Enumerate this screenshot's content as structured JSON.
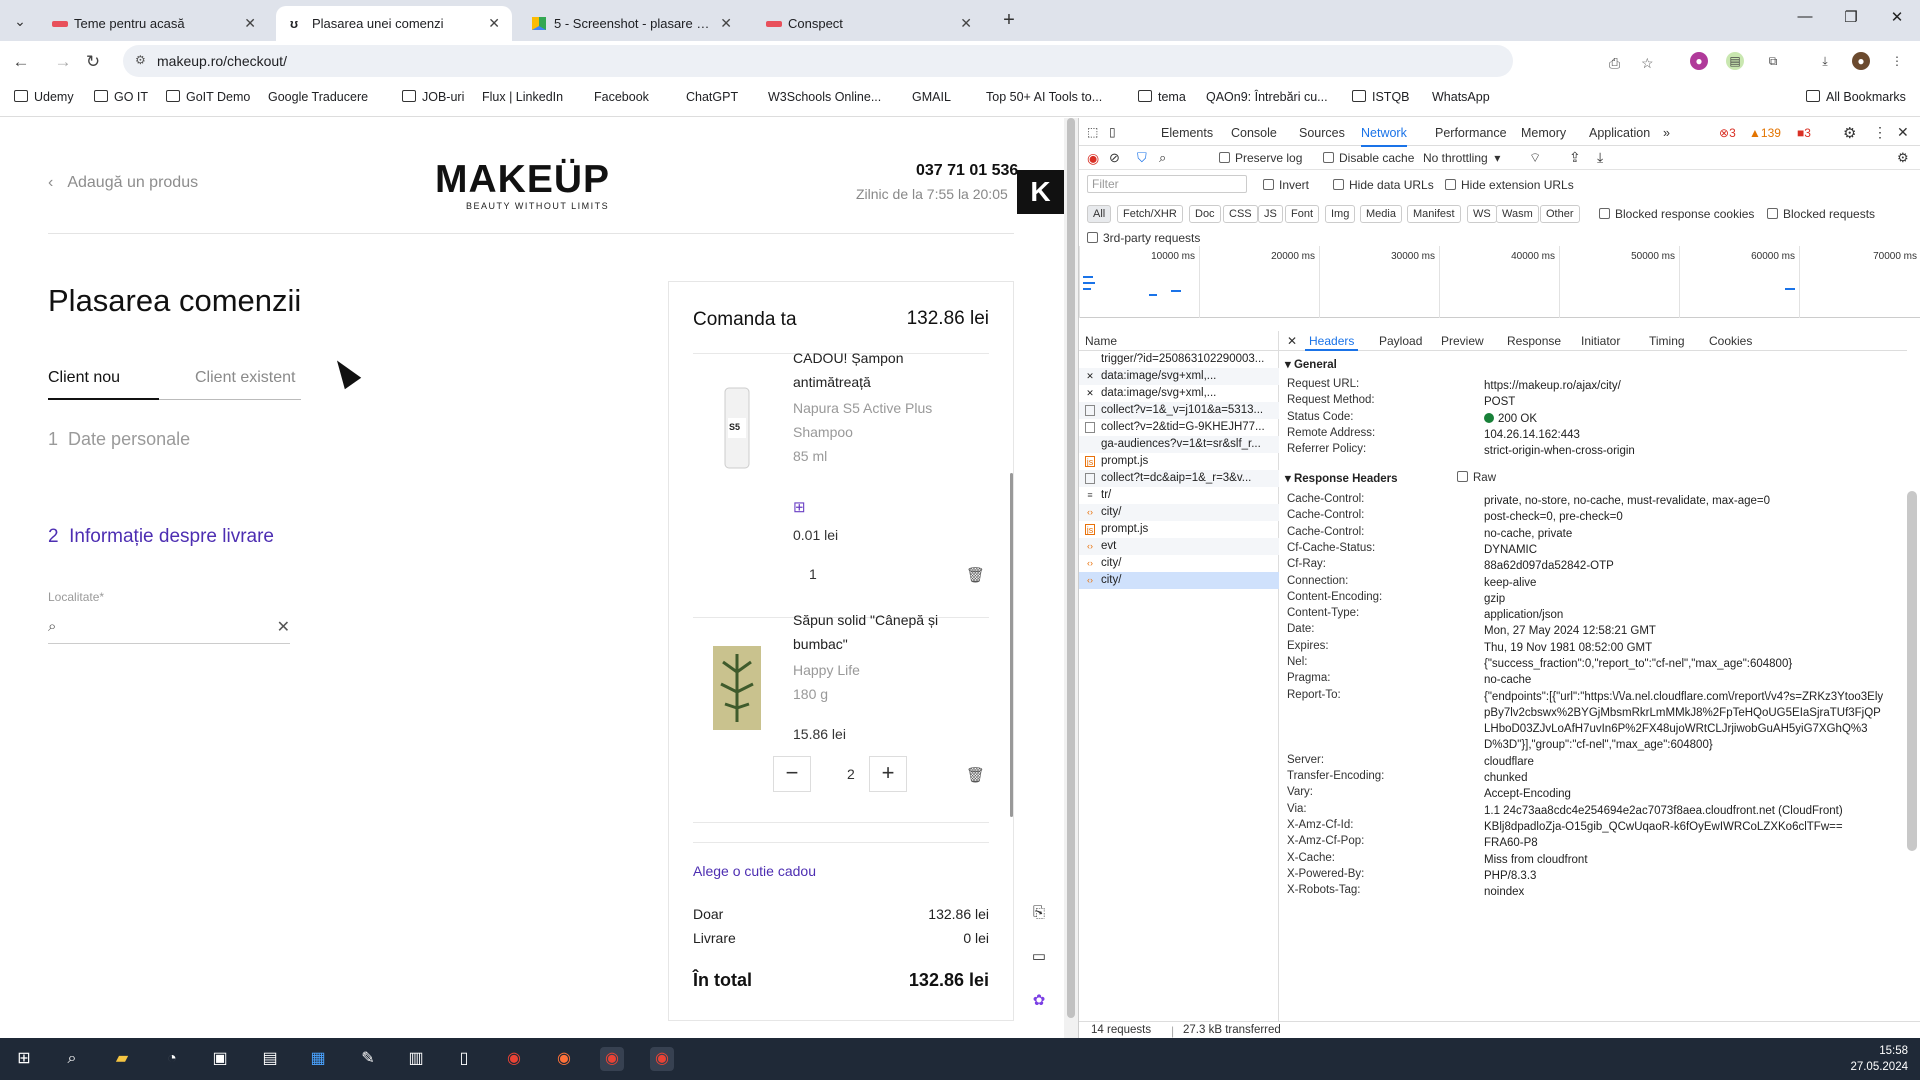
{
  "browser": {
    "tabs": [
      {
        "title": "Teme pentru acasă",
        "active": false
      },
      {
        "title": "Plasarea unei comenzi",
        "active": true
      },
      {
        "title": "5 - Screenshot - plasare comanda",
        "active": false
      },
      {
        "title": "Conspect",
        "active": false
      }
    ],
    "url": "makeup.ro/checkout/",
    "bookmarks": [
      "Udemy",
      "GO IT",
      "GoIT Demo",
      "Google Traducere",
      "JOB-uri",
      "Flux | LinkedIn",
      "Facebook",
      "ChatGPT",
      "W3Schools Online...",
      "GMAIL",
      "Top 50+ AI Tools to...",
      "tema",
      "QAOn9: Întrebări cu...",
      "ISTQB",
      "WhatsApp"
    ],
    "all_bookmarks": "All Bookmarks"
  },
  "site": {
    "back_label": "Adaugă un produs",
    "logo": "MAKEÜP",
    "logo_sub": "BEAUTY WITHOUT LIMITS",
    "phone": "037 71 01 536",
    "hours": "Zilnic de la 7:55 la 20:05",
    "badge": "K",
    "title": "Plasarea comenzii",
    "client_new": "Client nou",
    "client_existing": "Client existent",
    "step1_num": "1",
    "step1": "Date personale",
    "step2_num": "2",
    "step2": "Informație despre livrare",
    "locality_label": "Localitate*",
    "cart": {
      "title": "Comanda ta",
      "total": "132.86 lei",
      "items": [
        {
          "name": "CADOU! Șampon antimătreață",
          "brand": "Napura S5 Active Plus Shampoo",
          "volume": "85 ml",
          "price": "0.01 lei",
          "qty": "1"
        },
        {
          "name": "Săpun solid \"Cânepă și bumbac\"",
          "brand": "Happy Life",
          "volume": "180 g",
          "price": "15.86 lei",
          "qty": "2"
        }
      ],
      "gift_box": "Alege o cutie cadou",
      "subtotal_label": "Doar",
      "subtotal": "132.86 lei",
      "delivery_label": "Livrare",
      "delivery": "0 lei",
      "grand_label": "În total",
      "grand": "132.86 lei"
    }
  },
  "devtools": {
    "tabs": [
      "Elements",
      "Console",
      "Sources",
      "Network",
      "Performance",
      "Memory",
      "Application"
    ],
    "active_tab": "Network",
    "errors": "3",
    "warnings": "139",
    "issues": "3",
    "preserve_log": "Preserve log",
    "disable_cache": "Disable cache",
    "throttling": "No throttling",
    "filter_placeholder": "Filter",
    "invert": "Invert",
    "hide_data": "Hide data URLs",
    "hide_ext": "Hide extension URLs",
    "chips": [
      "All",
      "Fetch/XHR",
      "Doc",
      "CSS",
      "JS",
      "Font",
      "Img",
      "Media",
      "Manifest",
      "WS",
      "Wasm",
      "Other"
    ],
    "blocked_cookies": "Blocked response cookies",
    "blocked_requests": "Blocked requests",
    "third_party": "3rd-party requests",
    "ticks": [
      "10000 ms",
      "20000 ms",
      "30000 ms",
      "40000 ms",
      "50000 ms",
      "60000 ms",
      "70000 ms"
    ],
    "name_header": "Name",
    "requests": [
      "trigger/?id=250863102290003...",
      "data:image/svg+xml,...",
      "data:image/svg+xml,...",
      "collect?v=1&_v=j101&a=5313...",
      "collect?v=2&tid=G-9KHEJH77...",
      "ga-audiences?v=1&t=sr&slf_r...",
      "prompt.js",
      "collect?t=dc&aip=1&_r=3&v...",
      "tr/",
      "city/",
      "prompt.js",
      "evt",
      "city/",
      "city/"
    ],
    "detail_tabs": [
      "Headers",
      "Payload",
      "Preview",
      "Response",
      "Initiator",
      "Timing",
      "Cookies"
    ],
    "general_label": "General",
    "general": [
      [
        "Request URL:",
        "https://makeup.ro/ajax/city/"
      ],
      [
        "Request Method:",
        "POST"
      ],
      [
        "Status Code:",
        "200 OK"
      ],
      [
        "Remote Address:",
        "104.26.14.162:443"
      ],
      [
        "Referrer Policy:",
        "strict-origin-when-cross-origin"
      ]
    ],
    "resp_label": "Response Headers",
    "raw": "Raw",
    "response": [
      [
        "Cache-Control:",
        "private, no-store, no-cache, must-revalidate, max-age=0"
      ],
      [
        "Cache-Control:",
        "post-check=0, pre-check=0"
      ],
      [
        "Cache-Control:",
        "no-cache, private"
      ],
      [
        "Cf-Cache-Status:",
        "DYNAMIC"
      ],
      [
        "Cf-Ray:",
        "88a62d097da52842-OTP"
      ],
      [
        "Connection:",
        "keep-alive"
      ],
      [
        "Content-Encoding:",
        "gzip"
      ],
      [
        "Content-Type:",
        "application/json"
      ],
      [
        "Date:",
        "Mon, 27 May 2024 12:58:21 GMT"
      ],
      [
        "Expires:",
        "Thu, 19 Nov 1981 08:52:00 GMT"
      ],
      [
        "Nel:",
        "{\"success_fraction\":0,\"report_to\":\"cf-nel\",\"max_age\":604800}"
      ],
      [
        "Pragma:",
        "no-cache"
      ],
      [
        "Report-To:",
        "{\"endpoints\":[{\"url\":\"https:\\/\\/a.nel.cloudflare.com\\/report\\/v4?s=ZRKz3Ytoo3ElypBy7lv2cbswx%2BYGjMbsmRkrLmMMkJ8%2FpTeHQoUG5EIaSjraTUf3FjQPLHboD03ZJvLoAfH7uvIn6P%2FX48ujoWRtCLJrjiwobGuAH5yiG7XGhQ%3D%3D\"}],\"group\":\"cf-nel\",\"max_age\":604800}"
      ],
      [
        "Server:",
        "cloudflare"
      ],
      [
        "Transfer-Encoding:",
        "chunked"
      ],
      [
        "Vary:",
        "Accept-Encoding"
      ],
      [
        "Via:",
        "1.1 24c73aa8cdc4e254694e2ac7073f8aea.cloudfront.net (CloudFront)"
      ],
      [
        "X-Amz-Cf-Id:",
        "KBlj8dpadloZja-O15gib_QCwUqaoR-k6fOyEwIWRCoLZXKo6clTFw=="
      ],
      [
        "X-Amz-Cf-Pop:",
        "FRA60-P8"
      ],
      [
        "X-Cache:",
        "Miss from cloudfront"
      ],
      [
        "X-Powered-By:",
        "PHP/8.3.3"
      ],
      [
        "X-Robots-Tag:",
        "noindex"
      ]
    ],
    "footer_requests": "14 requests",
    "footer_transfer": "27.3 kB transferred"
  },
  "taskbar": {
    "time": "15:58",
    "date": "27.05.2024"
  },
  "colors": {
    "accent_purple": "#4d2eb2",
    "devtools_blue": "#1a73e8",
    "taskbar": "#1f2937"
  }
}
